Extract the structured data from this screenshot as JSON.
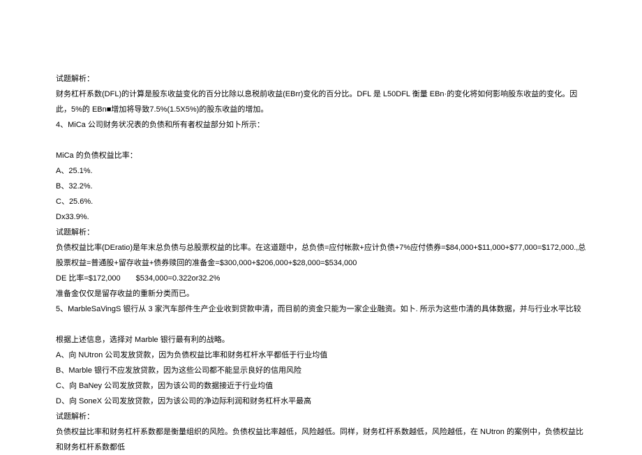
{
  "lines": {
    "l1": "试题解析：",
    "l2": "财务杠杆系数(DFL)的计算是股东收益变化的百分比除以息税前收益(EBrr)变化的百分比。DFL 是 L50DFL 衡量 EBn·的变化将如何影响股东收益的变化。因此，5%的 EBn■增加将导致7.5%(1.5X5%)的股东收益的增加。",
    "l3": "4、MiCa 公司财务状况表的负债和所有者权益部分如卜所示：",
    "l4": "MiCa 的负债权益比率：",
    "l5": "A、25.1%.",
    "l6": "B、32.2%.",
    "l7": "C、25.6%.",
    "l8": "Dx33.9%.",
    "l9": "试题解析：",
    "l10": "负债权益比率(DEratio)是年末总负债与总股票权益的比率。在这道题中，总负债=应付帐款+应计负债+7%应付债券=$84,000+$11,000+$77,000=$172,000.,总股票权益=普通股+留存收益+债券赎回的准备金=$300,000+$206,000+$28,000=$534,000",
    "l11": "DE 比率=$172,000  $534,000=0.322or32.2%",
    "l12": "准备金仅仅是留存收益的重新分类而已。",
    "l13": "5、MarbleSaVingS 银行从 3 家汽车部件生产企业收到贷款申清，而目前的资金只能为一家企业融资。如卜. 所示为这些巾清的具体数据，并与行业水平比较",
    "l14": "根据上述信息，选择对 Marble 银行最有利的战略。",
    "l15": "A、向 NUtron 公司发放贷款，因为负债权益比率和财务杠杆水平都低于行业均值",
    "l16": "B、Marble 银行不应发放贷款，因为这些公司都不能显示良好的信用风险",
    "l17": "C、向 BaNey 公司发放贷款，因为该公司的数据接近于行业均值",
    "l18": "D、向 SoneX 公司发放贷款，因为该公司的净边际利润和财务杠杆水平最高",
    "l19": "试题解析：",
    "l20": "负债权益比率和财务杠杆系数都是衡量组织的风险。负债权益比率越低，风险越低。同样，财务杠杆系数越低，风险越低，在 NUtron 的案例中，负债权益比和财务杠杆系数都低"
  }
}
